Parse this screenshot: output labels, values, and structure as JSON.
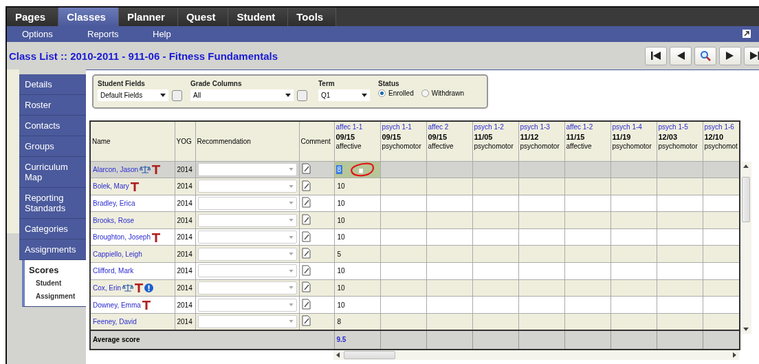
{
  "top_tabs": [
    {
      "label": "Pages",
      "selected": false
    },
    {
      "label": "Classes",
      "selected": true
    },
    {
      "label": "Planner",
      "selected": false
    },
    {
      "label": "Quest",
      "selected": false
    },
    {
      "label": "Student",
      "selected": false
    },
    {
      "label": "Tools",
      "selected": false
    }
  ],
  "sub_menu": [
    "Options",
    "Reports",
    "Help"
  ],
  "page_title": "Class List :: 2010-2011 - 911-06 - Fitness Fundamentals",
  "sidebar": {
    "items": [
      {
        "label": "Details",
        "selected": false
      },
      {
        "label": "Roster",
        "selected": false
      },
      {
        "label": "Contacts",
        "selected": false
      },
      {
        "label": "Groups",
        "selected": false
      },
      {
        "label": "Curriculum Map",
        "selected": false
      },
      {
        "label": "Reporting Standards",
        "selected": false
      },
      {
        "label": "Categories",
        "selected": false
      },
      {
        "label": "Assignments",
        "selected": false
      },
      {
        "label": "Scores",
        "selected": true,
        "children": [
          {
            "label": "Student"
          },
          {
            "label": "Assignment"
          }
        ]
      }
    ]
  },
  "filters": {
    "student_fields": {
      "label": "Student Fields",
      "value": "Default Fields"
    },
    "grade_columns": {
      "label": "Grade Columns",
      "value": "All"
    },
    "term": {
      "label": "Term",
      "value": "Q1"
    },
    "status": {
      "label": "Status",
      "options": [
        {
          "label": "Enrolled",
          "selected": true
        },
        {
          "label": "Withdrawn",
          "selected": false
        }
      ]
    }
  },
  "table": {
    "columns": [
      "Name",
      "YOG",
      "Recommendation",
      "Comment"
    ],
    "grade_columns": [
      {
        "name": "affec 1-1",
        "date": "09/15",
        "category": "affective"
      },
      {
        "name": "psych 1-1",
        "date": "09/15",
        "category": "psychomotor"
      },
      {
        "name": "affec 2",
        "date": "09/15",
        "category": "affective"
      },
      {
        "name": "psych 1-2",
        "date": "11/05",
        "category": "psychomotor"
      },
      {
        "name": "psych 1-3",
        "date": "11/12",
        "category": "psychomotor"
      },
      {
        "name": "affec 1-2",
        "date": "11/15",
        "category": "affective"
      },
      {
        "name": "psych 1-4",
        "date": "11/19",
        "category": "psychomotor"
      },
      {
        "name": "psych 1-5",
        "date": "12/03",
        "category": "psychomotor"
      },
      {
        "name": "psych 1-6",
        "date": "12/10",
        "category": "psychomot"
      }
    ],
    "rows": [
      {
        "name": "Alarcon, Jason",
        "icons": [
          {
            "kind": "scales"
          },
          {
            "kind": "medical"
          }
        ],
        "yog": "2014",
        "score": "8",
        "selected": true
      },
      {
        "name": "Bolek, Mary",
        "icons": [
          {
            "kind": "medical"
          }
        ],
        "yog": "2014",
        "score": "10",
        "selected": false
      },
      {
        "name": "Bradley, Erica",
        "icons": [],
        "yog": "2014",
        "score": "10",
        "selected": false
      },
      {
        "name": "Brooks, Rose",
        "icons": [],
        "yog": "2014",
        "score": "10",
        "selected": false
      },
      {
        "name": "Broughton, Joseph",
        "icons": [
          {
            "kind": "medical"
          }
        ],
        "yog": "2014",
        "score": "10",
        "selected": false
      },
      {
        "name": "Cappiello, Leigh",
        "icons": [],
        "yog": "2014",
        "score": "5",
        "selected": false
      },
      {
        "name": "Clifford, Mark",
        "icons": [],
        "yog": "2014",
        "score": "10",
        "selected": false
      },
      {
        "name": "Cox, Erin",
        "icons": [
          {
            "kind": "scales"
          },
          {
            "kind": "medical"
          },
          {
            "kind": "alert"
          }
        ],
        "yog": "2014",
        "score": "10",
        "selected": false
      },
      {
        "name": "Downey, Emma",
        "icons": [
          {
            "kind": "medical"
          }
        ],
        "yog": "2014",
        "score": "10",
        "selected": false
      },
      {
        "name": "Feeney, David",
        "icons": [],
        "yog": "2014",
        "score": "8",
        "selected": false
      }
    ],
    "footer": {
      "label": "Average score",
      "value": "9.5"
    }
  }
}
